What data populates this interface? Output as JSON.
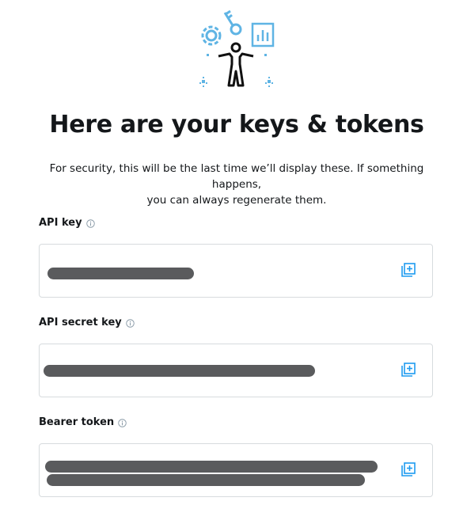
{
  "page": {
    "title": "Here are your keys & tokens",
    "subtitle_line1": "For security, this will be the last time we’ll display these. If something happens,",
    "subtitle_line2": "you can always regenerate them."
  },
  "illustration": {
    "icon": "person-with-keys-gear-chart-illustration",
    "accent_color": "#5fb4e4"
  },
  "fields": [
    {
      "label": "API key",
      "value_state": "redacted",
      "copy_icon": "copy-icon"
    },
    {
      "label": "API secret key",
      "value_state": "redacted",
      "copy_icon": "copy-icon"
    },
    {
      "label": "Bearer token",
      "value_state": "redacted",
      "copy_icon": "copy-icon"
    }
  ],
  "colors": {
    "text": "#14171a",
    "border": "#d7dbde",
    "redaction": "#5a5b5d",
    "copy_icon": "#1d9bf0",
    "info_icon": "#8899a6"
  }
}
